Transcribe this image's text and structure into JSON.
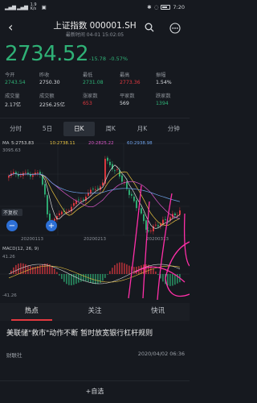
{
  "status": {
    "signal": "all",
    "speed": "1.9 K/s",
    "time": "7:20"
  },
  "header": {
    "title": "上证指数 000001.SH",
    "subtitle": "最新时间 04-01 15:02:05"
  },
  "quote": {
    "price": "2734.52",
    "change": "-15.78",
    "change_pct": "-0.57%"
  },
  "stats": [
    {
      "label": "今开",
      "value": "2743.54",
      "tone": "green"
    },
    {
      "label": "昨收",
      "value": "2750.30",
      "tone": "white"
    },
    {
      "label": "最低",
      "value": "2731.08",
      "tone": "green"
    },
    {
      "label": "最高",
      "value": "2773.36",
      "tone": "red"
    },
    {
      "label": "振幅",
      "value": "1.54%",
      "tone": "white"
    },
    {
      "label": "成交量",
      "value": "2.17亿",
      "tone": "white"
    },
    {
      "label": "成交额",
      "value": "2256.25亿",
      "tone": "white"
    },
    {
      "label": "涨家数",
      "value": "653",
      "tone": "red"
    },
    {
      "label": "平家数",
      "value": "569",
      "tone": "white"
    },
    {
      "label": "跌家数",
      "value": "1394",
      "tone": "green"
    }
  ],
  "periods": [
    "分时",
    "5日",
    "日K",
    "周K",
    "月K",
    "分钟"
  ],
  "active_period": 2,
  "chart": {
    "ma_label": "MA",
    "ma5": "5:2753.83",
    "ma10": "10:2738.11",
    "ma20": "20:2825.22",
    "ma60": "60:2938.98",
    "ytop": "3095.63",
    "ybottom": "2646.80",
    "restore_label": "不复权",
    "dates": [
      "20200113",
      "20200213",
      "20200313"
    ],
    "macd_label": "MACD(12, 26, 9)",
    "macd_top": "41.26",
    "macd_bottom": "-41.26",
    "colors": {
      "up": "#e2383f",
      "down": "#2fb176",
      "ma5": "#d7d7d7",
      "ma10": "#e8c341",
      "ma20": "#d957c8",
      "ma60": "#6ea1e8"
    }
  },
  "chart_data": {
    "type": "candlestick",
    "ma_values": {
      "MA5": 2753.83,
      "MA10": 2738.11,
      "MA20": 2825.22,
      "MA60": 2938.98
    },
    "ylim": [
      2646.8,
      3095.63
    ],
    "x_ticks": [
      "20200113",
      "20200213",
      "20200313"
    ],
    "macd_ylim": [
      -41.26,
      41.26
    ]
  },
  "tabs": [
    "热点",
    "关注",
    "快讯"
  ],
  "news": {
    "title": "美联储\"救市\"动作不断 暂时放宽银行杠杆规则",
    "source": "财联社",
    "time": "2020/04/02 06:36"
  },
  "bottom": {
    "add_label": "+自选"
  }
}
